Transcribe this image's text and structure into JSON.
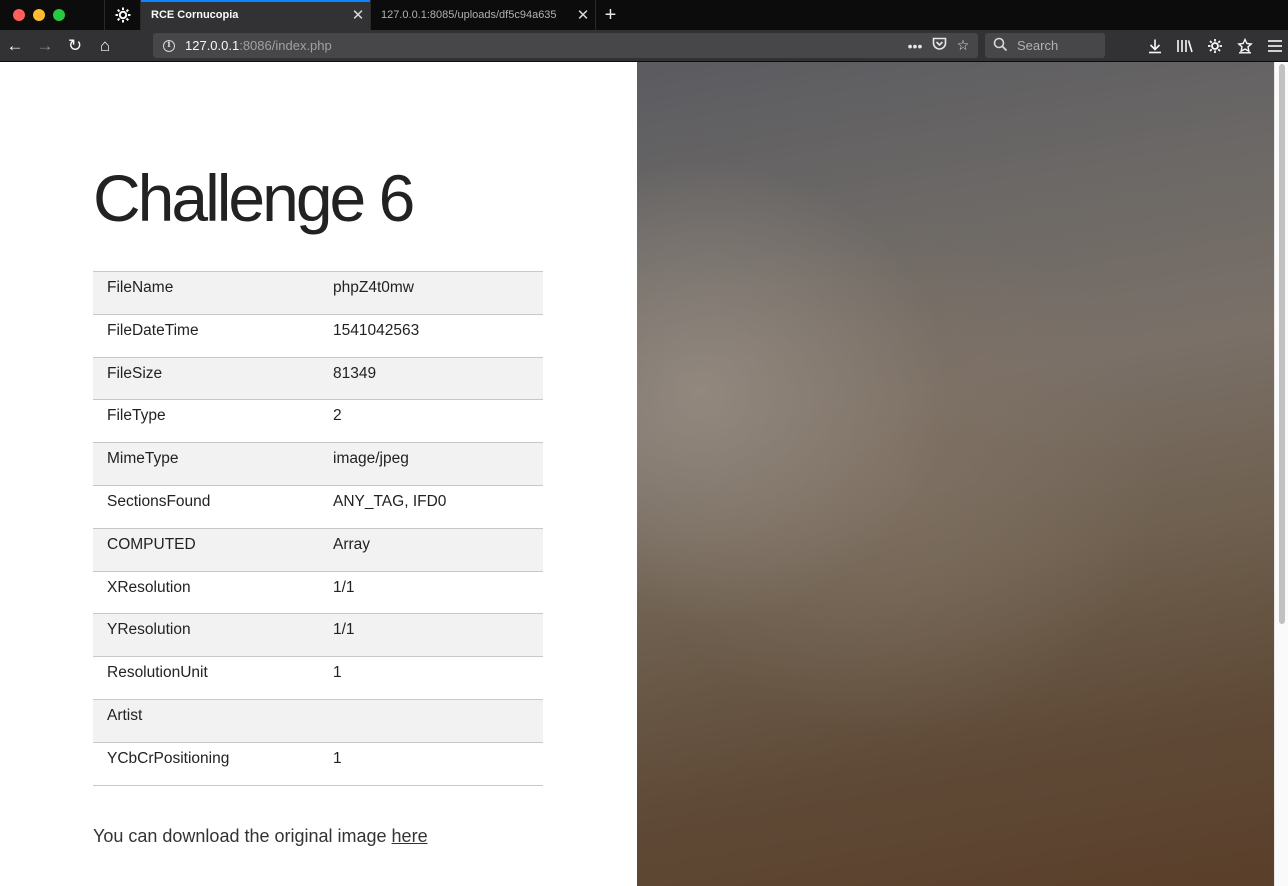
{
  "browser": {
    "tabs": [
      {
        "title": "RCE Cornucopia",
        "active": true
      },
      {
        "title": "127.0.0.1:8085/uploads/df5c94a635",
        "active": false
      }
    ],
    "url": {
      "host": "127.0.0.1",
      "rest": ":8086/index.php"
    },
    "search_placeholder": "Search",
    "icons": {
      "tab_close": "✕",
      "new_tab": "+",
      "back": "←",
      "forward": "→",
      "reload": "↻",
      "home": "⌂"
    }
  },
  "page": {
    "title": "Challenge 6",
    "rows": [
      {
        "key": "FileName",
        "value": "phpZ4t0mw"
      },
      {
        "key": "FileDateTime",
        "value": "1541042563"
      },
      {
        "key": "FileSize",
        "value": "81349"
      },
      {
        "key": "FileType",
        "value": "2"
      },
      {
        "key": "MimeType",
        "value": "image/jpeg"
      },
      {
        "key": "SectionsFound",
        "value": "ANY_TAG, IFD0"
      },
      {
        "key": "COMPUTED",
        "value": "Array"
      },
      {
        "key": "XResolution",
        "value": "1/1"
      },
      {
        "key": "YResolution",
        "value": "1/1"
      },
      {
        "key": "ResolutionUnit",
        "value": "1"
      },
      {
        "key": "Artist",
        "value": ""
      },
      {
        "key": "YCbCrPositioning",
        "value": "1"
      }
    ],
    "download_text": "You can download the original image ",
    "download_link": "here"
  }
}
